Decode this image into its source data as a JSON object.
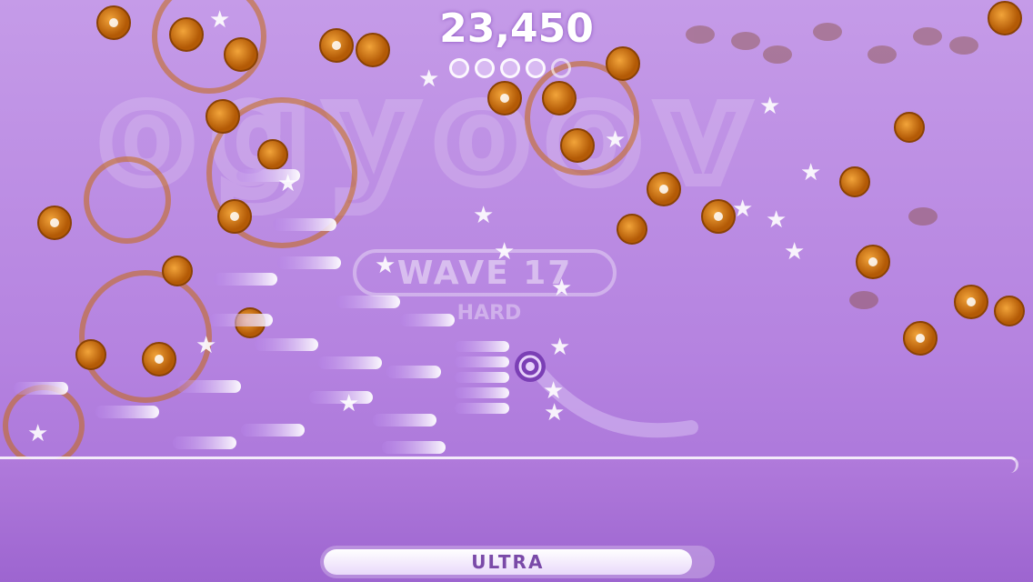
{
  "hud": {
    "score": "23,450",
    "lives_total": 5,
    "lives_remaining": 4
  },
  "wave": {
    "label": "WAVE 17",
    "difficulty": "HARD"
  },
  "power": {
    "label": "ULTRA",
    "level": 0.95
  },
  "colors": {
    "background": "#b583e0",
    "enemy": "#d9780f",
    "bullet": "#c9a2f2",
    "star": "#ffffff"
  }
}
